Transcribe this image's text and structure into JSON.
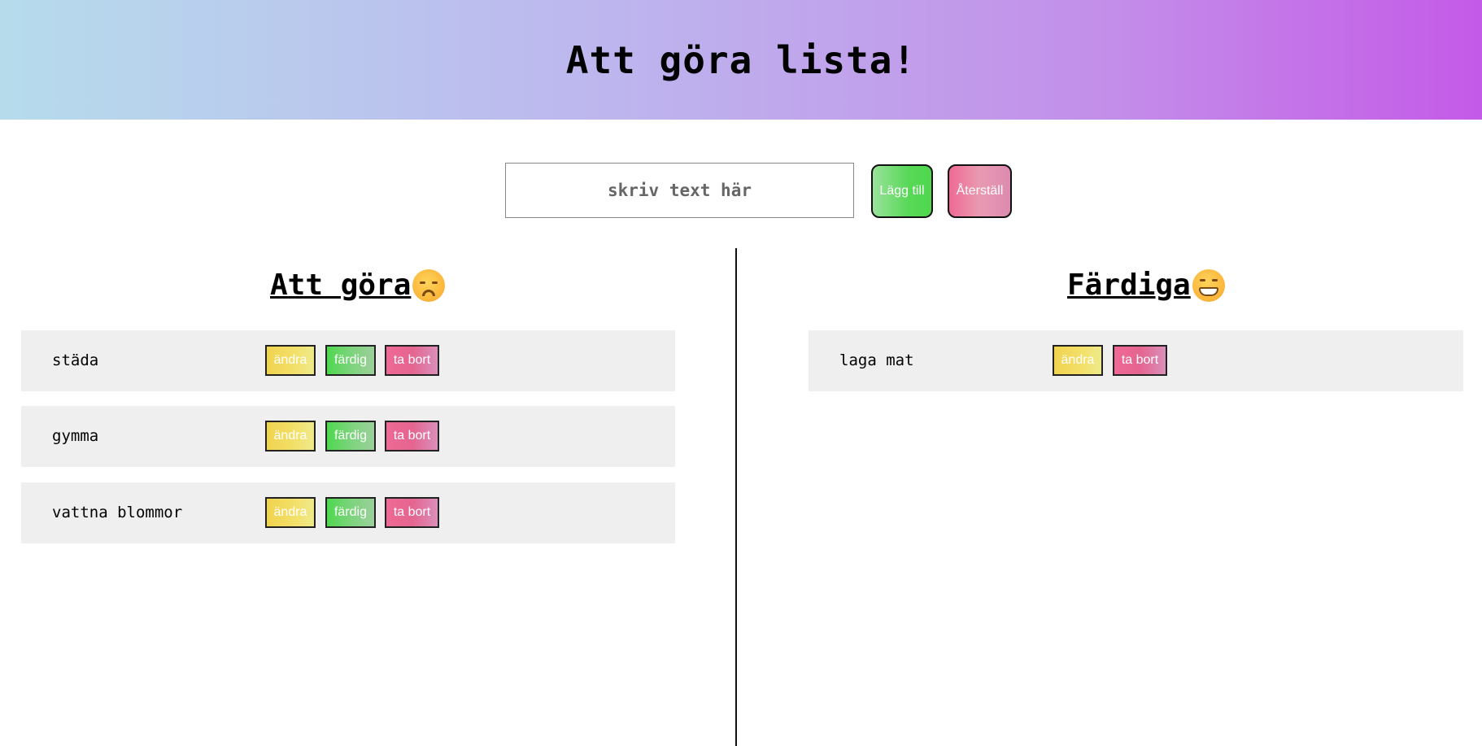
{
  "header": {
    "title": "Att göra lista!"
  },
  "form": {
    "input_placeholder": "skriv text här",
    "input_value": "",
    "add_label": "Lägg till",
    "reset_label": "Återställ"
  },
  "todo": {
    "title": "Att göra",
    "emoji": "sad-face-icon",
    "items": [
      {
        "text": "städa",
        "edit_label": "ändra",
        "done_label": "färdig",
        "delete_label": "ta bort"
      },
      {
        "text": "gymma",
        "edit_label": "ändra",
        "done_label": "färdig",
        "delete_label": "ta bort"
      },
      {
        "text": "vattna blommor",
        "edit_label": "ändra",
        "done_label": "färdig",
        "delete_label": "ta bort"
      }
    ]
  },
  "done": {
    "title": "Färdiga",
    "emoji": "grinning-face-icon",
    "items": [
      {
        "text": "laga mat",
        "edit_label": "ändra",
        "delete_label": "ta bort"
      }
    ]
  },
  "colors": {
    "header_gradient_start": "#b6dcec",
    "header_gradient_end": "#c45ae8",
    "item_background": "#efefef",
    "edit_yellow": "#f0d34e",
    "done_green": "#4ed84e",
    "delete_pink": "#ef6a95"
  }
}
